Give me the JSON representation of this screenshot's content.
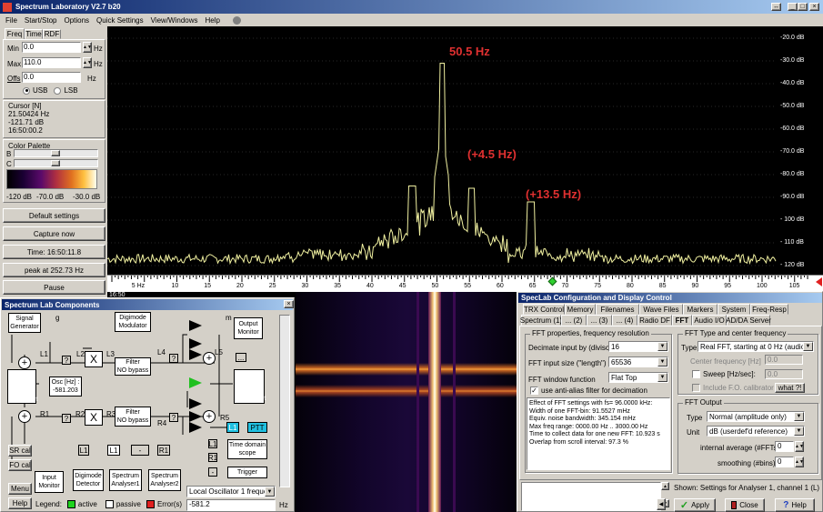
{
  "window": {
    "title": "Spectrum Laboratory V2.7 b20"
  },
  "menu": [
    "File",
    "Start/Stop",
    "Options",
    "Quick Settings",
    "View/Windows",
    "Help"
  ],
  "left": {
    "tabs": [
      "Freq",
      "Time",
      "RDF"
    ],
    "min_label": "Min",
    "min_value": "0.0",
    "max_label": "Max",
    "max_value": "110.0",
    "unit": "Hz",
    "offs_label": "Offs",
    "offs_value": "0.0",
    "usb": "USB",
    "lsb": "LSB",
    "cursor_title": "Cursor [N]",
    "cursor_lines": [
      "21.50424 Hz",
      "-121.71 dB",
      "16:50:00.2"
    ],
    "palette_title": "Color Palette",
    "b": "B",
    "c": "C",
    "palette_scale": [
      "-120 dB",
      "-70.0 dB",
      "-30.0 dB"
    ],
    "buttons": [
      "Default settings",
      "Capture now",
      "Time:  16:50:11.8",
      "peak at 252.73 Hz",
      "Pause"
    ]
  },
  "spectrum": {
    "db_labels": [
      "-20.0 dB",
      "-30.0 dB",
      "-40.0 dB",
      "-50.0 dB",
      "-60.0 dB",
      "-70.0 dB",
      "-80.0 dB",
      "-90.0 dB",
      "- 100 dB",
      "- 110 dB",
      "- 120 dB"
    ],
    "freq_labels": [
      "5 Hz",
      "10",
      "15",
      "20",
      "25",
      "30",
      "35",
      "40",
      "45",
      "50",
      "55",
      "60",
      "65",
      "70",
      "75",
      "80",
      "85",
      "90",
      "95",
      "100",
      "105"
    ],
    "annotations": [
      "50.5 Hz",
      "(+4.5 Hz)",
      "(+13.5 Hz)"
    ],
    "time_stamp": "16:50"
  },
  "components": {
    "title": "Spectrum Lab Components",
    "blocks": {
      "sig": "Signal\nGenerator",
      "digi": "Digimode\nModulator",
      "outmon": "Output\nMonitor",
      "adc": "Mono\nADC",
      "adc_r": "Right",
      "dac": "Mono\nDAC",
      "dac_r": "Right",
      "osc": "Osc [Hz] :\n-581.203",
      "filter": "Filter\nNO bypass",
      "tds": "Time domain\nscope",
      "trigger": "Trigger",
      "inmon": "Input\nMonitor",
      "digidet": "Digimode\nDetector",
      "sa1": "Spectrum\nAnalyser1",
      "sa2": "Spectrum\nAnalyser2"
    },
    "labels": {
      "g": "g",
      "m": "m",
      "L1": "L1",
      "L2": "L2",
      "L3": "L3",
      "L4": "L4",
      "L5": "L5",
      "R1": "R1",
      "R2": "R2",
      "R3": "R3",
      "R4": "R4",
      "R5": "R5",
      "q": "?",
      "x": "X",
      "ptt": "PTT",
      "dots": "...",
      "minus": "-"
    },
    "side": [
      "SR cal",
      "FO cal",
      "Menu",
      "Help"
    ],
    "legend": "Legend:",
    "active": "active",
    "passive": "passive",
    "error": "Error(s)",
    "param_select": "Local Oscillator 1 frequency",
    "param_value": "-581.2",
    "param_unit": "Hz"
  },
  "config": {
    "title": "SpecLab  Configuration and Display Control",
    "tabs1": [
      "TRX Control",
      "Memory",
      "Filenames",
      "Wave Files",
      "Markers",
      "System",
      "Freq-Resp"
    ],
    "tabs2": [
      "Spectrum (1)",
      "... (2)",
      "... (3)",
      "... (4)",
      "Radio DF",
      "FFT",
      "Audio I/O",
      "AD/DA Server"
    ],
    "fft_group": "FFT properties, frequency resolution",
    "decimate_label": "Decimate input by (divisor)",
    "decimate_value": "16",
    "size_label": "FFT input size (\"length\")",
    "size_value": "65536",
    "window_label": "FFT window function",
    "window_value": "Flat Top",
    "antialias": "use anti-alias filter for decimation",
    "info": [
      "Effect of FFT settings with fs= 96.0000 kHz:",
      "Width of one FFT-bin: 91.5527 mHz",
      "Equiv. noise bandwidth: 345.154 mHz",
      "Max freq range: 0000.00 Hz .. 3000.00 Hz",
      "Time to collect data for one new FFT: 10.923 s",
      "Overlap from scroll interval: 97.3 %"
    ],
    "type_group": "FFT Type and center frequency",
    "type_label": "Type",
    "type_value": "Real FFT, starting at 0 Hz (audio)",
    "center_label": "Center frequency [Hz]",
    "center_value": "0.0",
    "sweep_label": "Sweep [Hz/sec]:",
    "sweep_value": "0.0",
    "include_fo": "Include F.O. calibrator",
    "what": "what ?!",
    "output_group": "FFT Output",
    "out_type_label": "Type",
    "out_type_value": "Normal (amplitude only)",
    "unit_label": "Unit",
    "unit_value": "dB (userdef'd reference)",
    "avg_label": "internal average (#FFTs)",
    "avg_value": "0",
    "smooth_label": "smoothing (#bins)",
    "smooth_value": "0",
    "shown": "Shown: Settings for Analyser 1, channel 1 (L)",
    "apply": "Apply",
    "close": "Close",
    "help": "Help"
  }
}
